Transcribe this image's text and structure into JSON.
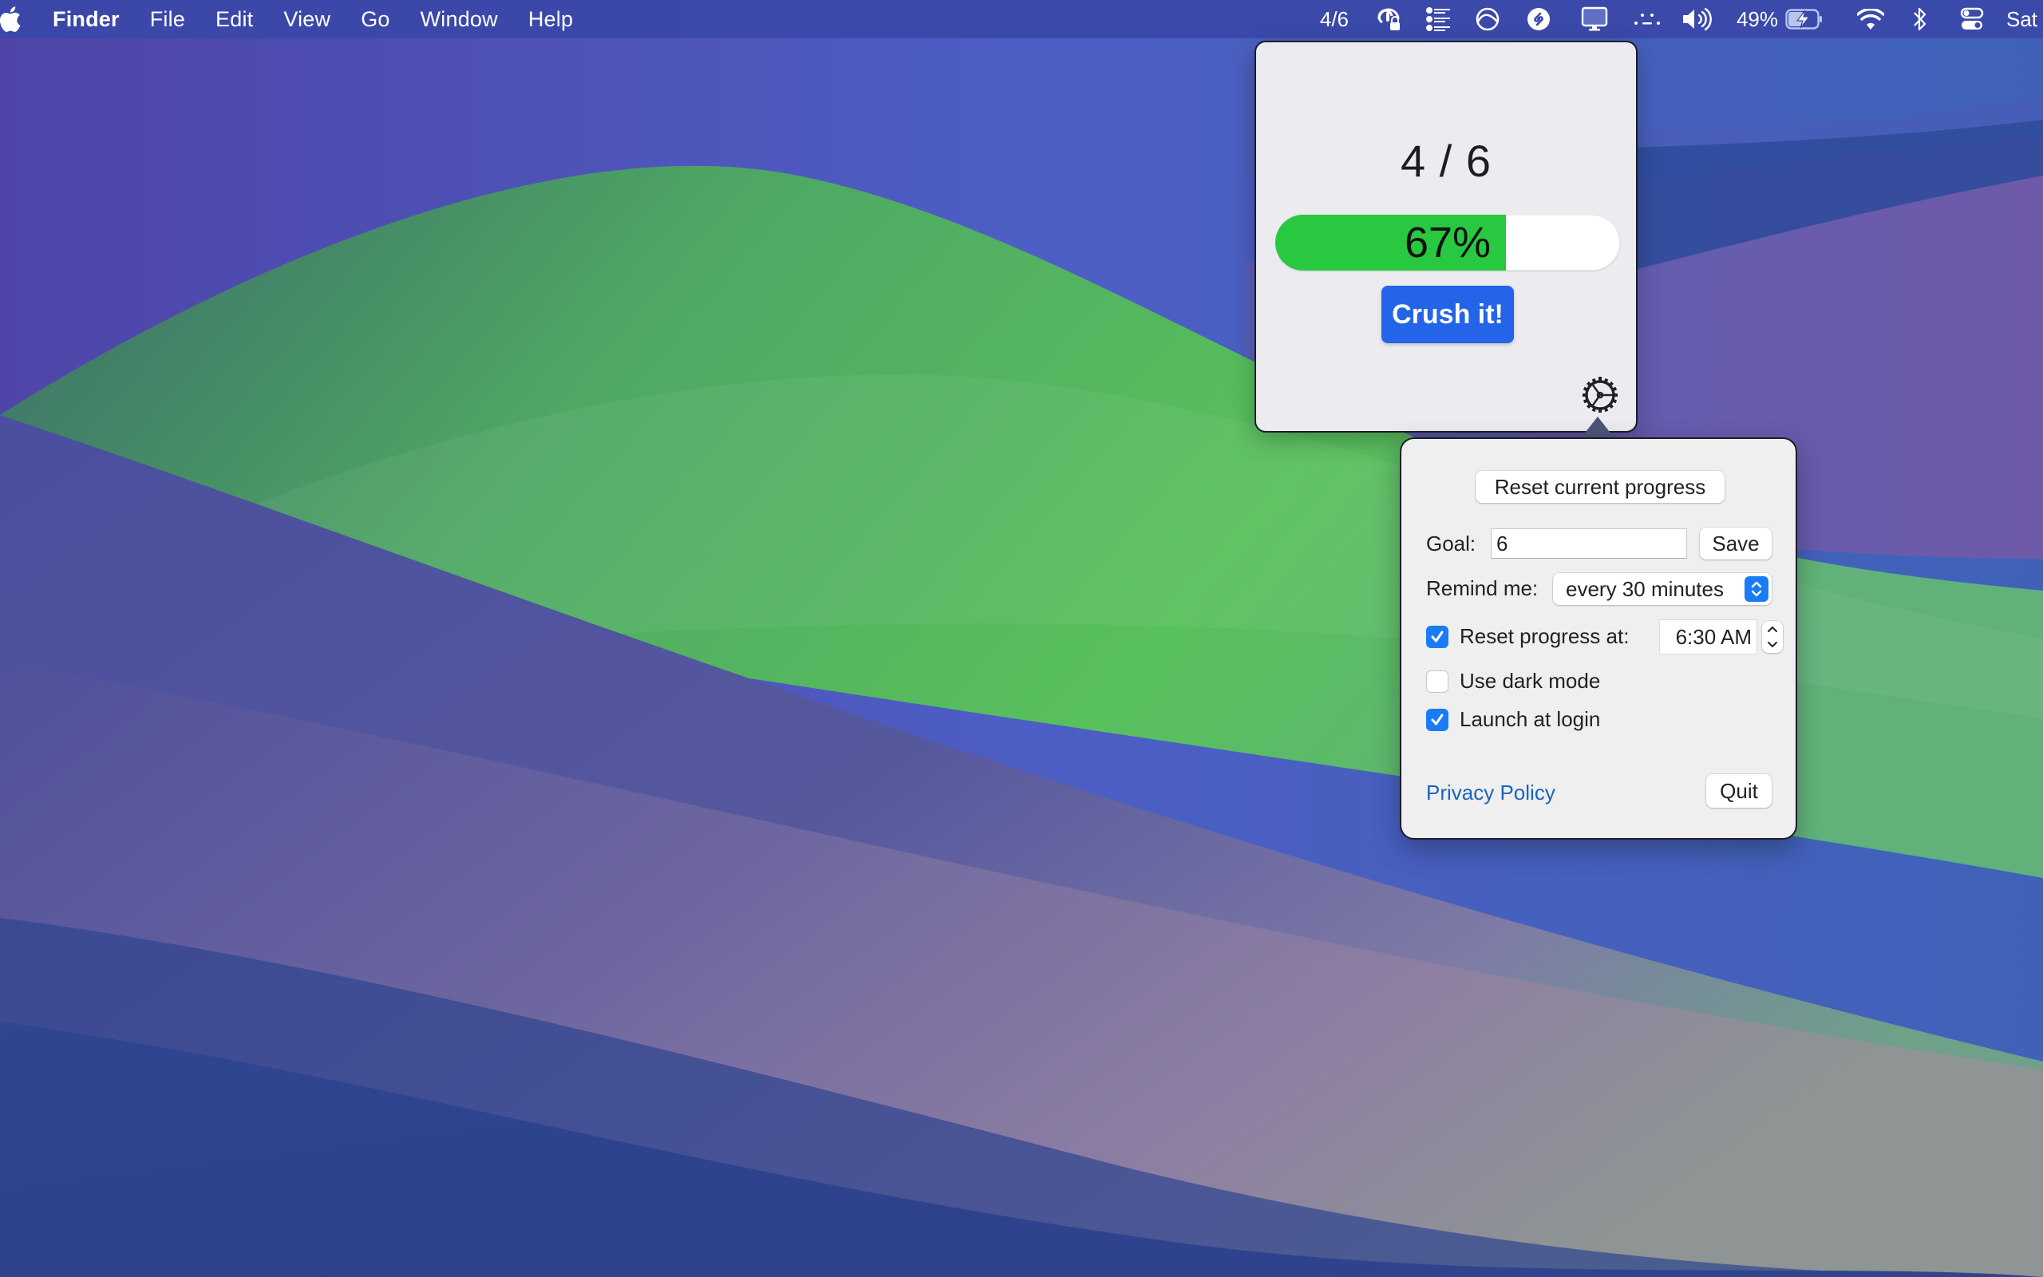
{
  "menubar": {
    "apple_icon": "apple-logo-icon",
    "app_name": "Finder",
    "menus": [
      "File",
      "Edit",
      "View",
      "Go",
      "Window",
      "Help"
    ],
    "status_items": {
      "app_counter": "4/6",
      "icons": [
        "vpn-lock-icon",
        "list-icon",
        "istat-icon",
        "shazam-icon",
        "display-icon",
        "dots-icon",
        "volume-icon"
      ],
      "battery_percent": "49%",
      "battery_icon": "battery-charging-icon",
      "wifi_icon": "wifi-icon",
      "bluetooth_icon": "bluetooth-icon",
      "control_center_icon": "control-center-icon",
      "clock": "Sat"
    }
  },
  "progress_popover": {
    "count_text": "4 / 6",
    "completed": 4,
    "goal": 6,
    "progress_percent": 67,
    "progress_label": "67%",
    "action_button": "Crush it!",
    "settings_icon": "gear-icon",
    "colors": {
      "progress_fill": "#28c840",
      "action_button": "#2364e8"
    }
  },
  "settings_popover": {
    "reset_button": "Reset current progress",
    "goal_label": "Goal:",
    "goal_value": "6",
    "save_button": "Save",
    "remind_label": "Remind me:",
    "remind_value": "every 30 minutes",
    "reset_at_label": "Reset progress at:",
    "reset_at_checked": true,
    "reset_time": "6:30 AM",
    "dark_mode_label": "Use dark mode",
    "dark_mode_checked": false,
    "launch_login_label": "Launch at login",
    "launch_login_checked": true,
    "privacy_link": "Privacy Policy",
    "quit_button": "Quit",
    "colors": {
      "accent": "#1a7cf5",
      "link": "#1a64c0"
    }
  }
}
